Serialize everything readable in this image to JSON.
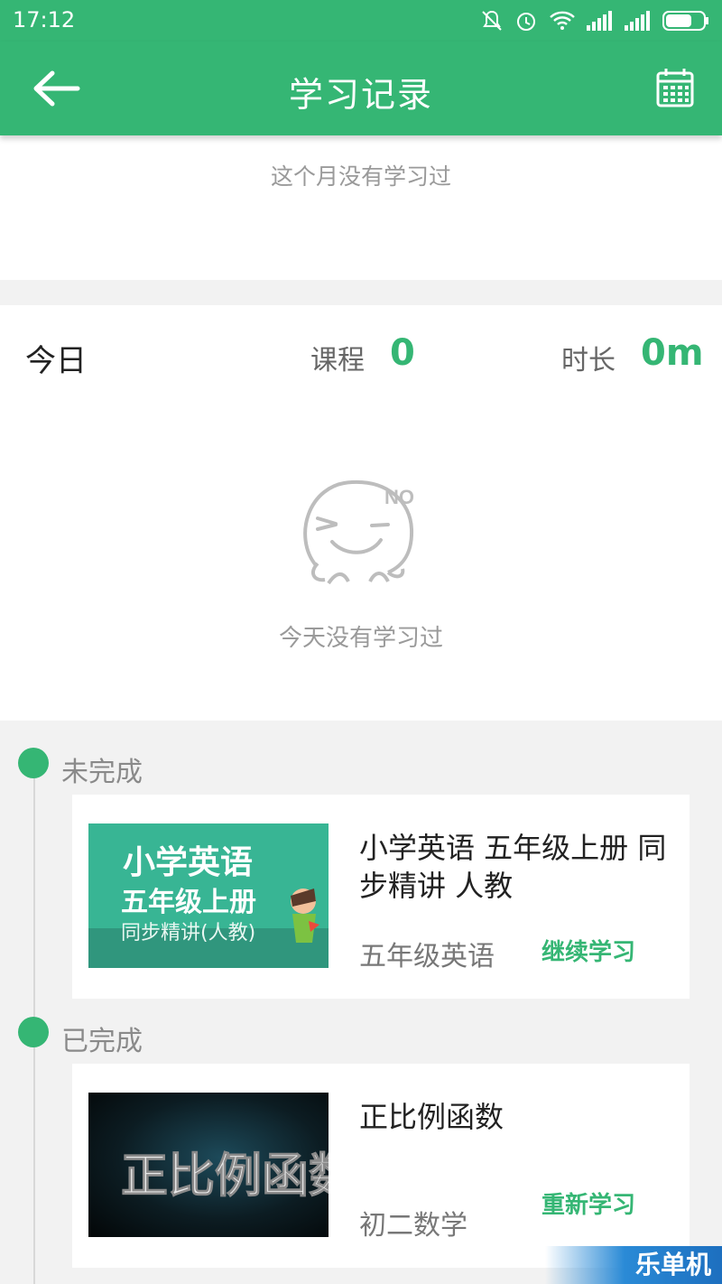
{
  "status_bar": {
    "time": "17:12",
    "icons": [
      "mute-bell-icon",
      "alarm-icon",
      "wifi-icon",
      "signal-icon",
      "signal-icon",
      "battery-icon"
    ]
  },
  "header": {
    "title": "学习记录",
    "back_icon": "back-arrow-icon",
    "calendar_icon": "calendar-icon"
  },
  "month": {
    "empty_text": "这个月没有学习过"
  },
  "today": {
    "label": "今日",
    "course_label": "课程",
    "course_value": "0",
    "duration_label": "时长",
    "duration_value": "0m",
    "empty_text": "今天没有学习过",
    "empty_face_text": "NO"
  },
  "sections": [
    {
      "label": "未完成",
      "course": {
        "thumb_lines": [
          "小学英语",
          "五年级上册",
          "同步精讲(人教)"
        ],
        "title": "小学英语 五年级上册 同步精讲 人教",
        "subtitle": "五年级英语",
        "action": "继续学习"
      }
    },
    {
      "label": "已完成",
      "course": {
        "thumb_text": "正比例函数",
        "title": "正比例函数",
        "subtitle": "初二数学",
        "action": "重新学习"
      }
    }
  ],
  "watermark": "乐单机",
  "colors": {
    "primary": "#35b674",
    "muted_text": "#9a9a9a",
    "background": "#f2f2f2"
  }
}
